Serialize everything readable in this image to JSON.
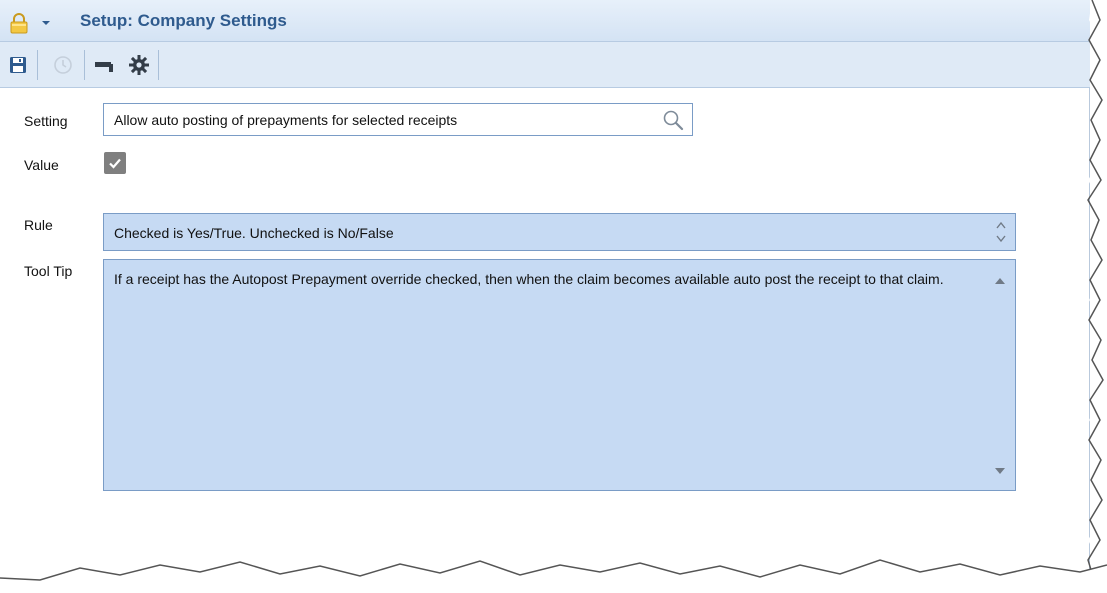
{
  "window": {
    "title": "Setup: Company Settings"
  },
  "toolbar": {
    "buttons": [
      {
        "icon": "save-icon"
      },
      {
        "icon": "clock-icon"
      },
      {
        "icon": "stamp-icon"
      },
      {
        "icon": "gear-icon"
      }
    ]
  },
  "form": {
    "setting_label": "Setting",
    "setting_value": "Allow auto posting of prepayments for selected receipts",
    "value_label": "Value",
    "value_checked": true,
    "rule_label": "Rule",
    "rule_value": "Checked is Yes/True. Unchecked is No/False",
    "tooltip_label": "Tool Tip",
    "tooltip_value": "If a receipt has the Autopost Prepayment override checked, then when the claim becomes available auto post the receipt to that claim."
  },
  "colors": {
    "title": "#2f5b8e",
    "field_fill": "#c6daf3",
    "field_border": "#7a9cc6",
    "toolbar_bg": "#dfeaf6"
  }
}
